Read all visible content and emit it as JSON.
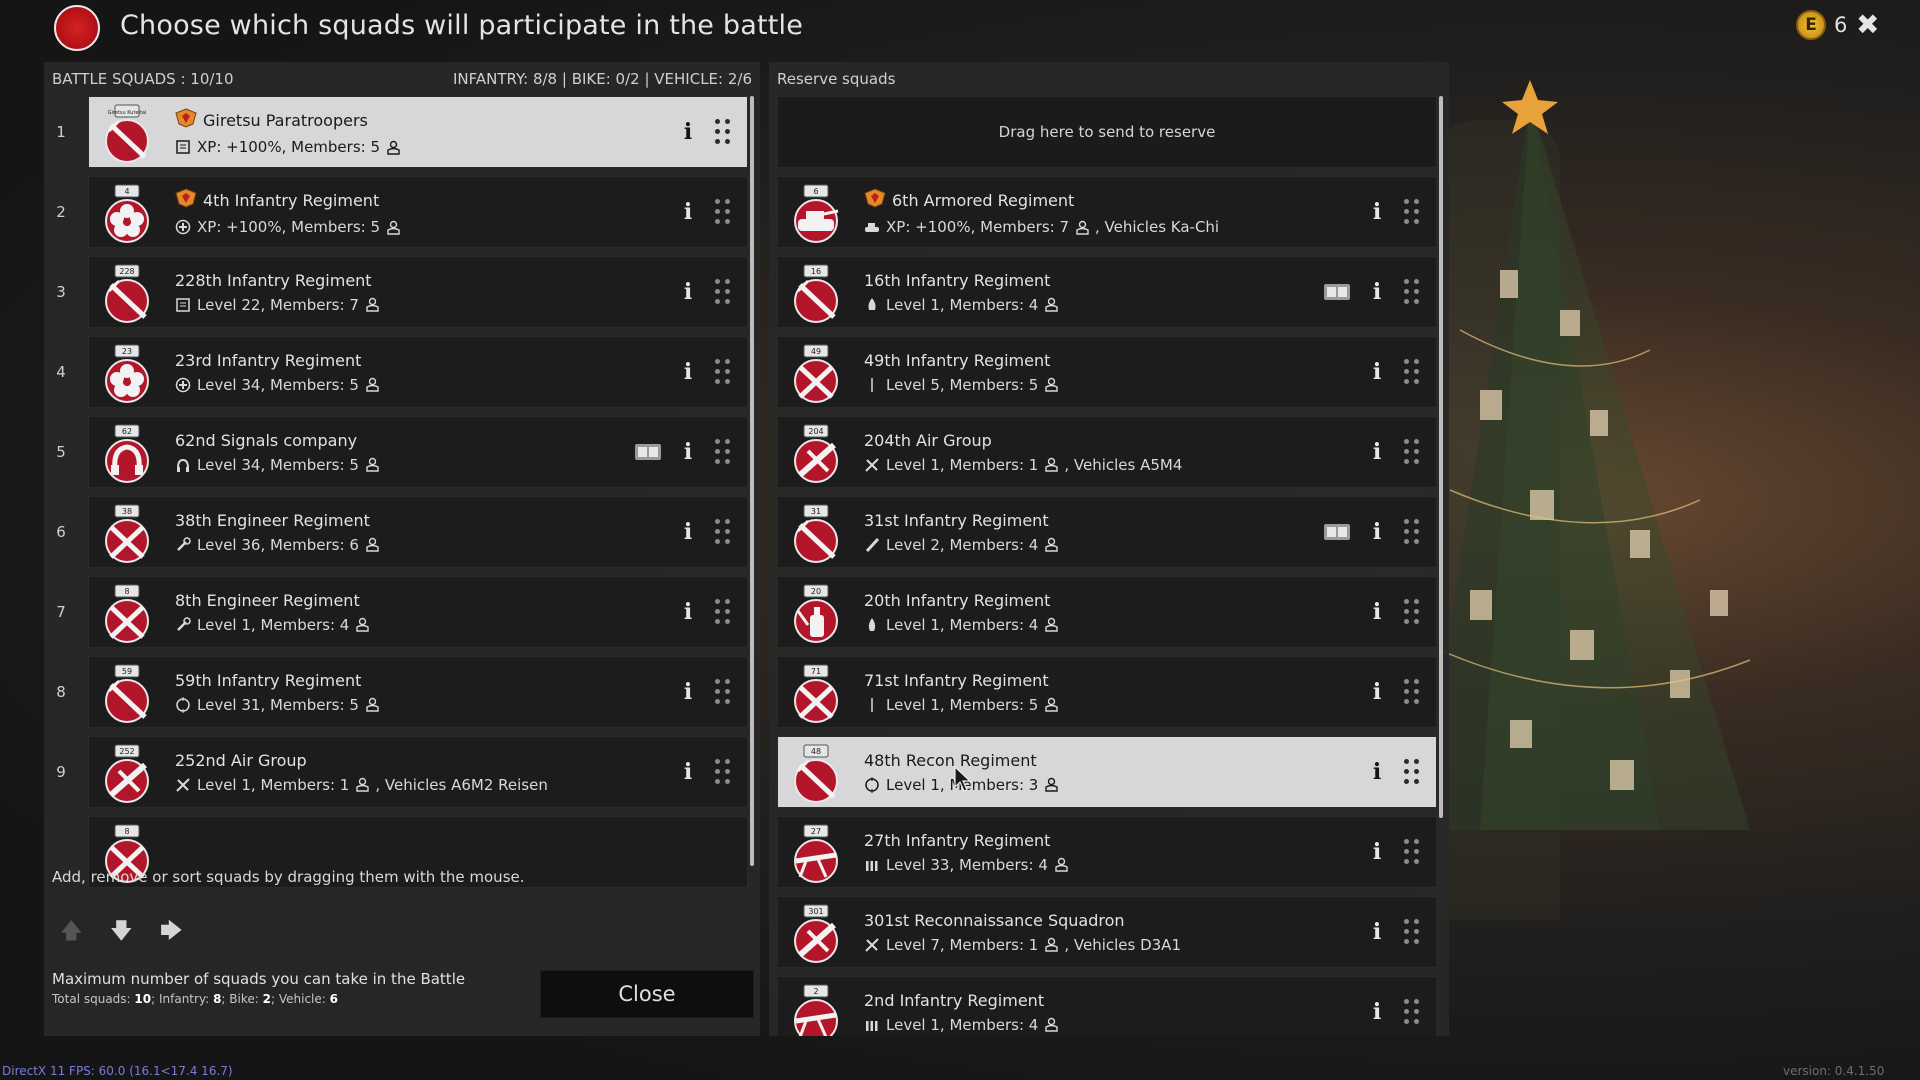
{
  "header": {
    "title": "Choose which squads will participate in the battle",
    "currency_value": "6",
    "currency_symbol": "E"
  },
  "battle": {
    "header_left": "BATTLE SQUADS : 10/10",
    "header_right": "INFANTRY: 8/8 | BIKE: 0/2 | VEHICLE: 2/6",
    "squads": [
      {
        "num": "1",
        "name": "Giretsu Paratroopers",
        "info": "XP: +100%, Members: 5",
        "cls": "radio",
        "elite": true,
        "selected": true,
        "book": false,
        "emblem_label": "Giretsu Kuteitai",
        "emblem": "sword"
      },
      {
        "num": "2",
        "name": "4th Infantry Regiment",
        "info": "XP: +100%, Members: 5",
        "cls": "medic",
        "elite": true,
        "selected": false,
        "book": false,
        "emblem_label": "4",
        "emblem": "flower"
      },
      {
        "num": "3",
        "name": "228th Infantry Regiment",
        "info": "Level 22, Members: 7",
        "cls": "radio",
        "elite": false,
        "selected": false,
        "book": false,
        "emblem_label": "228",
        "emblem": "sword"
      },
      {
        "num": "4",
        "name": "23rd Infantry Regiment",
        "info": "Level 34, Members: 5",
        "cls": "medic",
        "elite": false,
        "selected": false,
        "book": false,
        "emblem_label": "23",
        "emblem": "flower"
      },
      {
        "num": "5",
        "name": "62nd Signals company",
        "info": "Level 34, Members: 5",
        "cls": "headset",
        "elite": false,
        "selected": false,
        "book": true,
        "emblem_label": "62",
        "emblem": "phone"
      },
      {
        "num": "6",
        "name": "38th Engineer Regiment",
        "info": "Level 36, Members: 6",
        "cls": "wrench",
        "elite": false,
        "selected": false,
        "book": false,
        "emblem_label": "38",
        "emblem": "cross"
      },
      {
        "num": "7",
        "name": "8th Engineer Regiment",
        "info": "Level 1, Members: 4",
        "cls": "wrench",
        "elite": false,
        "selected": false,
        "book": false,
        "emblem_label": "8",
        "emblem": "cross"
      },
      {
        "num": "8",
        "name": "59th Infantry Regiment",
        "info": "Level 31, Members: 5",
        "cls": "scope",
        "elite": false,
        "selected": false,
        "book": false,
        "emblem_label": "59",
        "emblem": "sword"
      },
      {
        "num": "9",
        "name": "252nd Air Group",
        "info": "Level 1, Members: 1",
        "cls": "plane",
        "elite": false,
        "selected": false,
        "book": false,
        "emblem_label": "252",
        "emblem": "plane",
        "vehicles": ", Vehicles A6M2 Reisen"
      },
      {
        "num": "",
        "name": "",
        "info": "",
        "cls": "",
        "elite": false,
        "selected": false,
        "book": false,
        "emblem_label": "8",
        "emblem": "cross"
      }
    ],
    "help_text": "Add, remove or sort squads by dragging them with the mouse.",
    "limits_title": "Maximum number of squads you can take in the Battle",
    "limits_total_label": "Total squads:",
    "limits_total": "10",
    "limits_infantry_label": "; Infantry:",
    "limits_infantry": "8",
    "limits_bike_label": "; Bike:",
    "limits_bike": "2",
    "limits_vehicle_label": "; Vehicle:",
    "limits_vehicle": "6",
    "close_label": "Close"
  },
  "reserve": {
    "header": "Reserve squads",
    "drop_text": "Drag here to send to reserve",
    "squads": [
      {
        "name": "6th Armored Regiment",
        "info": "XP: +100%, Members: 7",
        "cls": "tank",
        "elite": true,
        "selected": false,
        "book": false,
        "emblem_label": "6",
        "emblem": "tank",
        "vehicles": ", Vehicles Ka-Chi"
      },
      {
        "name": "16th Infantry Regiment",
        "info": "Level 1, Members: 4",
        "cls": "fire",
        "elite": false,
        "selected": false,
        "book": true,
        "emblem_label": "16",
        "emblem": "sword"
      },
      {
        "name": "49th Infantry Regiment",
        "info": "Level 5, Members: 5",
        "cls": "line",
        "elite": false,
        "selected": false,
        "book": false,
        "emblem_label": "49",
        "emblem": "cross"
      },
      {
        "name": "204th Air Group",
        "info": "Level 1, Members: 1",
        "cls": "plane",
        "elite": false,
        "selected": false,
        "book": false,
        "emblem_label": "204",
        "emblem": "plane",
        "vehicles": ", Vehicles A5M4"
      },
      {
        "name": "31st Infantry Regiment",
        "info": "Level 2, Members: 4",
        "cls": "knife",
        "elite": false,
        "selected": false,
        "book": true,
        "emblem_label": "31",
        "emblem": "sword"
      },
      {
        "name": "20th Infantry Regiment",
        "info": "Level 1, Members: 4",
        "cls": "flame",
        "elite": false,
        "selected": false,
        "book": false,
        "emblem_label": "20",
        "emblem": "bottle"
      },
      {
        "name": "71st Infantry Regiment",
        "info": "Level 1, Members: 5",
        "cls": "line",
        "elite": false,
        "selected": false,
        "book": false,
        "emblem_label": "71",
        "emblem": "cross"
      },
      {
        "name": "48th Recon Regiment",
        "info": "Level 1, Members: 3",
        "cls": "scope",
        "elite": false,
        "selected": true,
        "book": false,
        "emblem_label": "48",
        "emblem": "sword"
      },
      {
        "name": "27th Infantry Regiment",
        "info": "Level 33, Members: 4",
        "cls": "ammo",
        "elite": false,
        "selected": false,
        "book": false,
        "emblem_label": "27",
        "emblem": "mg"
      },
      {
        "name": "301st Reconnaissance Squadron",
        "info": "Level 7, Members: 1",
        "cls": "plane",
        "elite": false,
        "selected": false,
        "book": false,
        "emblem_label": "301",
        "emblem": "plane",
        "vehicles": ", Vehicles D3A1"
      },
      {
        "name": "2nd Infantry Regiment",
        "info": "Level 1, Members: 4",
        "cls": "ammo",
        "elite": false,
        "selected": false,
        "book": false,
        "emblem_label": "2",
        "emblem": "mg"
      }
    ]
  },
  "footer": {
    "debug": "DirectX 11 FPS: 60.0 (16.1<17.4 16.7)",
    "version": "version: 0.4.1.50"
  },
  "colors": {
    "emblem_red": "#b3162a",
    "selected_bg": "#d7d7d9",
    "card_bg": "#1c1c1c",
    "elite_orange": "#e08a2a"
  }
}
